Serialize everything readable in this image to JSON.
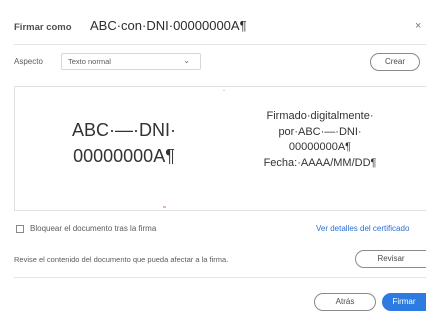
{
  "header": {
    "label": "Firmar como",
    "identity": "ABC·con·DNI·00000000A¶",
    "close_glyph": "×"
  },
  "appearance": {
    "label": "Aspecto",
    "selected": "Texto normal",
    "create_button": "Crear"
  },
  "preview": {
    "name_lines": [
      "ABC·—·DNI·",
      "00000000A¶"
    ],
    "detail_lines": [
      "Firmado·digitalmente·",
      "por·ABC·—·DNI·",
      "00000000A¶",
      "Fecha:·AAAA/MM/DD¶"
    ]
  },
  "options": {
    "lock_label": "Bloquear el documento tras la firma",
    "lock_checked": false,
    "details_link": "Ver detalles del certificado"
  },
  "review": {
    "text": "Revise el contenido del documento que pueda afectar a la firma.",
    "button": "Revisar"
  },
  "footer": {
    "back_button": "Atrás",
    "sign_button": "Firmar"
  },
  "colors": {
    "primary": "#2d7be0",
    "link": "#2a6fd4"
  }
}
